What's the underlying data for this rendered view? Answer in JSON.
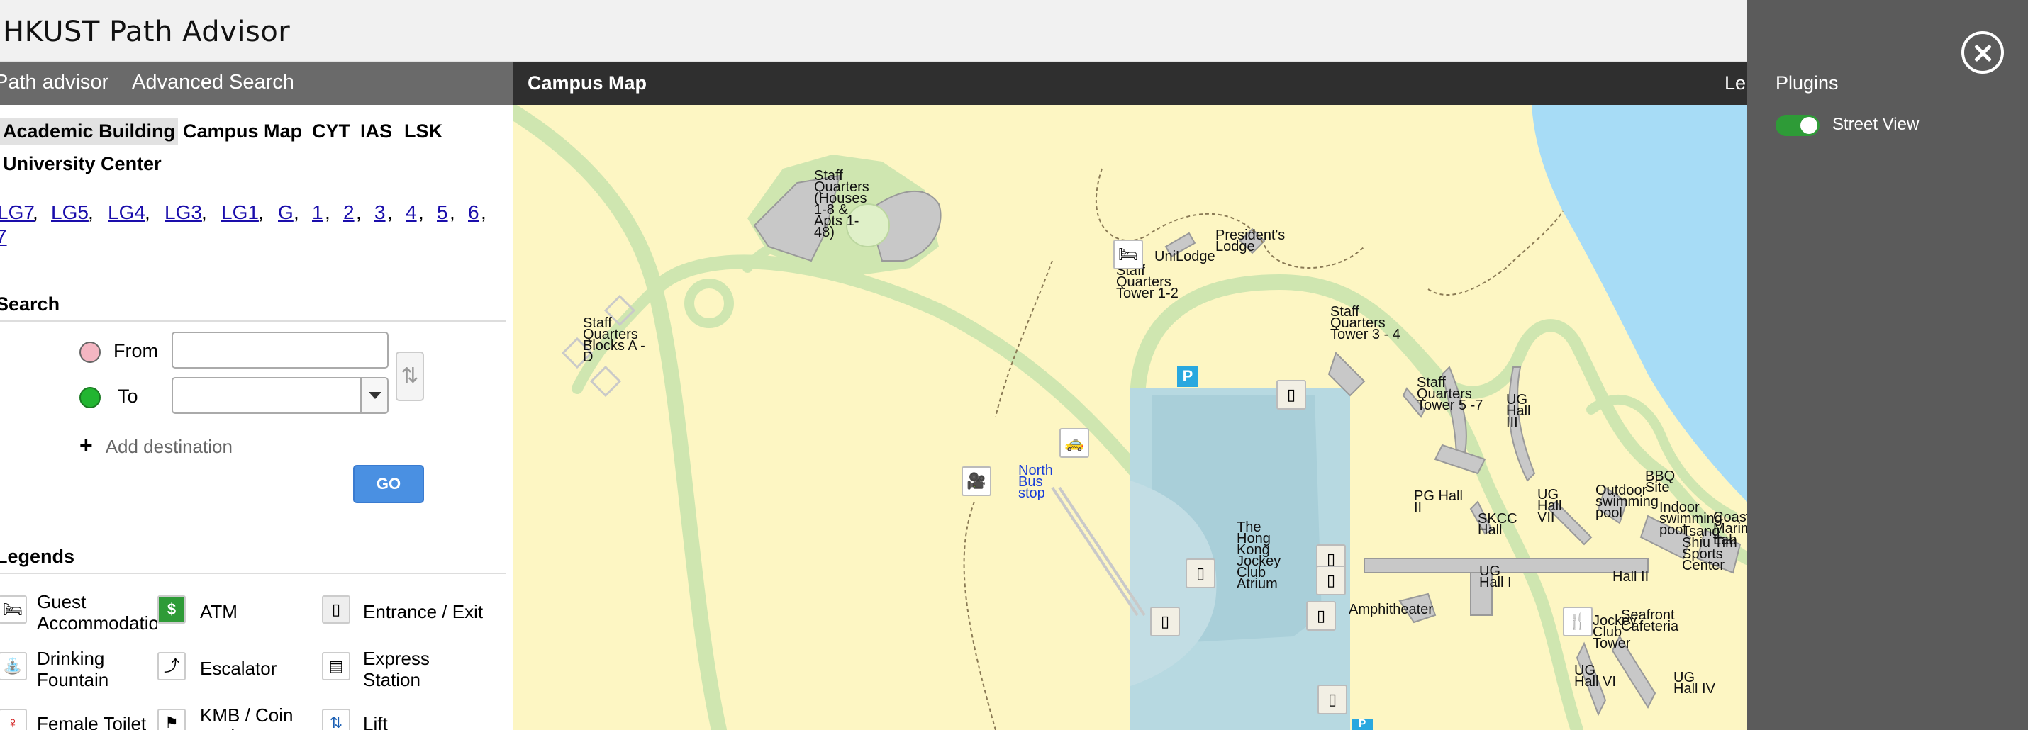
{
  "app": {
    "title": "HKUST Path Advisor"
  },
  "left_nav": {
    "path_advisor": "Path advisor",
    "advanced_search": "Advanced Search"
  },
  "building_tabs": [
    {
      "label": "Academic Building",
      "active": true
    },
    {
      "label": "Campus Map",
      "active": false
    },
    {
      "label": "CYT",
      "active": false
    },
    {
      "label": "IAS",
      "active": false
    },
    {
      "label": "LSK",
      "active": false
    },
    {
      "label": "University Center",
      "active": false
    }
  ],
  "floors": [
    "LG7",
    "LG5",
    "LG4",
    "LG3",
    "LG1",
    "G",
    "1",
    "2",
    "3",
    "4",
    "5",
    "6",
    "7"
  ],
  "search": {
    "title": "Search",
    "from_label": "From",
    "from_value": "",
    "to_label": "To",
    "to_value": "",
    "from_color": "#f4b6c2",
    "to_color": "#22b531",
    "add_destination": "Add destination",
    "go_label": "GO"
  },
  "legends": {
    "title": "Legends",
    "items": [
      {
        "label": "Guest Accommodation",
        "icon": "bed-icon"
      },
      {
        "label": "ATM",
        "icon": "atm-icon"
      },
      {
        "label": "Entrance / Exit",
        "icon": "door-icon"
      },
      {
        "label": "Drinking Fountain",
        "icon": "fountain-icon"
      },
      {
        "label": "Escalator",
        "icon": "escalator-icon"
      },
      {
        "label": "Express Station",
        "icon": "express-station-icon"
      },
      {
        "label": "Female Toilet",
        "icon": "female-toilet-icon"
      },
      {
        "label": "KMB / Coin Exchange",
        "icon": "kmb-icon"
      },
      {
        "label": "Lift",
        "icon": "lift-icon"
      }
    ]
  },
  "map": {
    "toolbar_title": "Campus Map",
    "toolbar_right": "Le",
    "labels": {
      "staff_quarters_houses": "Staff Quarters (Houses 1-8 & Apts 1-48)",
      "staff_quarters_blocks": "Staff Quarters Blocks A - D",
      "unilodge": "UniLodge",
      "presidents_lodge": "President's Lodge",
      "sq_tower_12": "Staff Quarters Tower 1-2",
      "sq_tower_34": "Staff Quarters Tower 3 - 4",
      "sq_tower_57": "Staff Quarters Tower 5 -7",
      "ug_hall_iii": "UG Hall III",
      "north_bus_stop": "North Bus stop",
      "pg_hall_ii": "PG Hall II",
      "skcc_hall": "SKCC Hall",
      "ug_hall_vii": "UG Hall VII",
      "outdoor_pool": "Outdoor swimming pool",
      "bbq_site": "BBQ Site",
      "indoor_pool": "Indoor swimming pool",
      "tsang_shiu_tim": "Tsang Shiu Tim Sports Center",
      "coastal_marine_lab": "Coastal Marine Lab",
      "atrium": "The Hong Kong Jockey Club Atrium",
      "ug_hall_i": "UG Hall I",
      "hall_ii": "Hall II",
      "amphitheater": "Amphitheater",
      "jockey_club_tower": "Jockey Club Tower",
      "seafront_cafeteria": "Seafront Cafeteria",
      "ug_hall_vi": "UG Hall VI",
      "ug_hall_iv": "UG Hall IV",
      "parking": "P"
    }
  },
  "plugins": {
    "title": "Plugins",
    "items": [
      {
        "label": "Street View",
        "enabled": true
      }
    ]
  }
}
